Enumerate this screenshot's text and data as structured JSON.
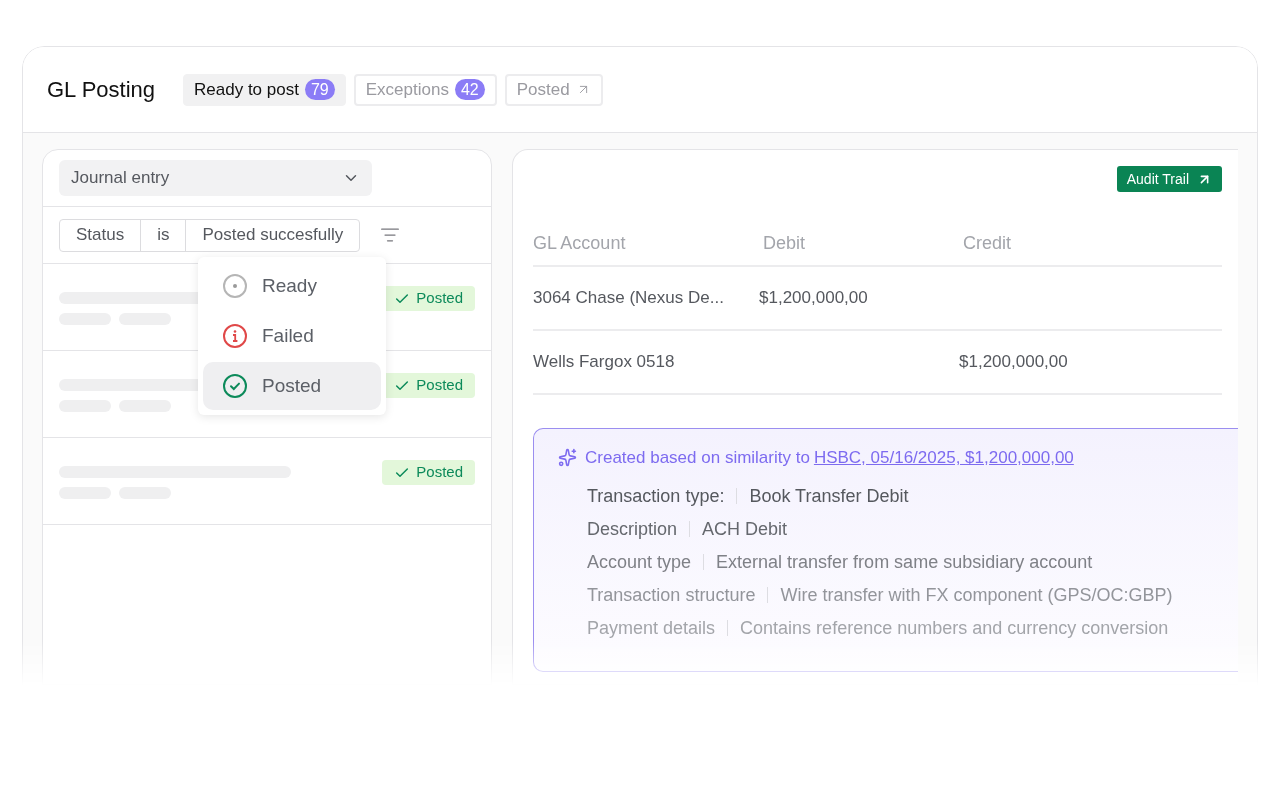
{
  "header": {
    "title": "GL Posting"
  },
  "tabs": [
    {
      "label": "Ready to post",
      "count": "79",
      "selected": true,
      "external": false
    },
    {
      "label": "Exceptions",
      "count": "42",
      "selected": false,
      "external": false
    },
    {
      "label": "Posted",
      "selected": false,
      "external": true
    }
  ],
  "left_panel": {
    "entity_select": {
      "value": "Journal entry"
    },
    "filter": {
      "field": "Status",
      "operator": "is",
      "value": "Posted succesfully"
    },
    "rows": [
      {
        "status": "Posted"
      },
      {
        "status": "Posted"
      },
      {
        "status": "Posted"
      }
    ],
    "status_menu": [
      {
        "label": "Ready",
        "kind": "ready",
        "selected": false
      },
      {
        "label": "Failed",
        "kind": "failed",
        "selected": false
      },
      {
        "label": "Posted",
        "kind": "posted",
        "selected": true
      }
    ]
  },
  "right_panel": {
    "audit_button": "Audit Trail",
    "table": {
      "columns": [
        "GL Account",
        "Debit",
        "Credit"
      ],
      "rows": [
        [
          "3064 Chase (Nexus De...",
          "$1,200,000,00",
          ""
        ],
        [
          "Wells Fargox 0518",
          "",
          "$1,200,000,00"
        ]
      ]
    },
    "suggestion": {
      "intro": "Created based on similarity to",
      "link": "HSBC, 05/16/2025, $1,200,000,00",
      "details": [
        {
          "label": "Transaction type:",
          "value": "Book Transfer Debit"
        },
        {
          "label": "Description",
          "value": "ACH Debit"
        },
        {
          "label": "Account type",
          "value": "External transfer from same subsidiary account"
        },
        {
          "label": "Transaction structure",
          "value": "Wire transfer with FX component (GPS/OC:GBP)"
        },
        {
          "label": "Payment details",
          "value": "Contains reference numbers and currency conversion"
        }
      ]
    }
  }
}
